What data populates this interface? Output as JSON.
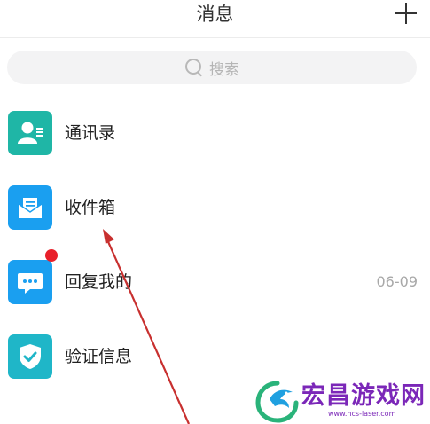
{
  "header": {
    "title": "消息",
    "add_icon": "plus-icon"
  },
  "search": {
    "placeholder": "搜索",
    "icon": "search-icon"
  },
  "list": [
    {
      "label": "通讯录",
      "icon": "contacts-icon",
      "color": "#1fb6a6",
      "time": "",
      "unread_dot": false
    },
    {
      "label": "收件箱",
      "icon": "mail-icon",
      "color": "#1a9ff0",
      "time": "",
      "unread_dot": false
    },
    {
      "label": "回复我的",
      "icon": "chat-bubble-icon",
      "color": "#1a9ff0",
      "time": "06-09",
      "unread_dot": true
    },
    {
      "label": "验证信息",
      "icon": "shield-check-icon",
      "color": "#1fb6c8",
      "time": "",
      "unread_dot": false
    }
  ],
  "annotation": {
    "arrow_color": "#c8302f"
  },
  "watermark": {
    "name": "宏昌游戏网",
    "url": "www.hcs-laser.com",
    "color": "#7b27b8"
  }
}
